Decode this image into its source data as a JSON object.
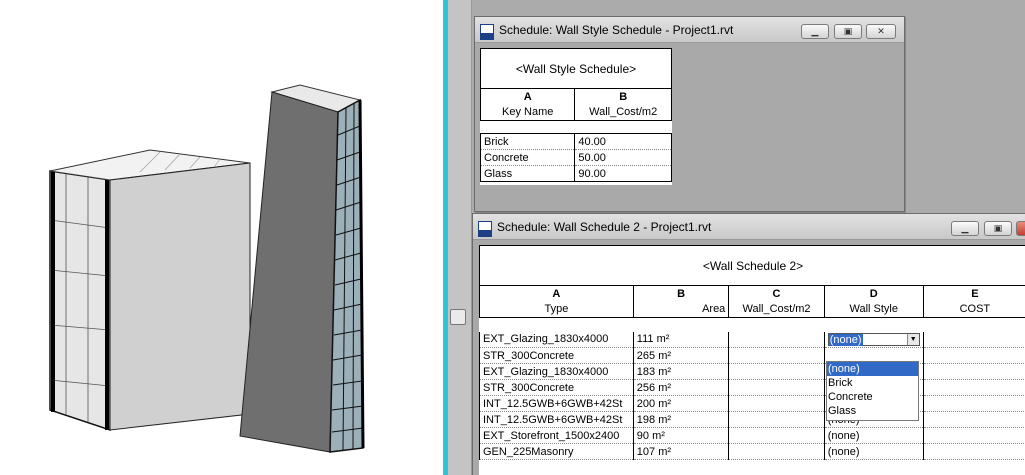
{
  "colors": {
    "divider": "#2ec5d8",
    "selection": "#3169c6",
    "workspace": "#ababab"
  },
  "window1": {
    "title": "Schedule: Wall Style Schedule - Project1.rvt",
    "schedule_title": "<Wall Style Schedule>",
    "column_letters": [
      "A",
      "B"
    ],
    "column_names": [
      "Key Name",
      "Wall_Cost/m2"
    ],
    "rows": [
      [
        "Brick",
        "40.00"
      ],
      [
        "Concrete",
        "50.00"
      ],
      [
        "Glass",
        "90.00"
      ]
    ]
  },
  "window2": {
    "title": "Schedule: Wall Schedule 2 - Project1.rvt",
    "schedule_title": "<Wall Schedule 2>",
    "column_letters": [
      "A",
      "B",
      "C",
      "D",
      "E"
    ],
    "column_names": [
      "Type",
      "Area",
      "Wall_Cost/m2",
      "Wall Style",
      "COST"
    ],
    "rows": [
      [
        "EXT_Glazing_1830x4000",
        "111 m²",
        "",
        "(none)",
        ""
      ],
      [
        "STR_300Concrete",
        "265 m²",
        "",
        "",
        ""
      ],
      [
        "EXT_Glazing_1830x4000",
        "183 m²",
        "",
        "",
        ""
      ],
      [
        "STR_300Concrete",
        "256 m²",
        "",
        "",
        ""
      ],
      [
        "INT_12.5GWB+6GWB+42St",
        "200 m²",
        "",
        "",
        ""
      ],
      [
        "INT_12.5GWB+6GWB+42St",
        "198 m²",
        "",
        "(none)",
        ""
      ],
      [
        "EXT_Storefront_1500x2400",
        "90 m²",
        "",
        "(none)",
        ""
      ],
      [
        "GEN_225Masonry",
        "107 m²",
        "",
        "(none)",
        ""
      ]
    ],
    "dropdown": {
      "value": "(none)",
      "options": [
        "(none)",
        "Brick",
        "Concrete",
        "Glass"
      ],
      "highlighted": "(none)"
    }
  },
  "icons": {
    "minimize": "minimize-icon",
    "restore": "restore-icon",
    "close": "close-icon",
    "window_app": "revit-file-icon"
  }
}
